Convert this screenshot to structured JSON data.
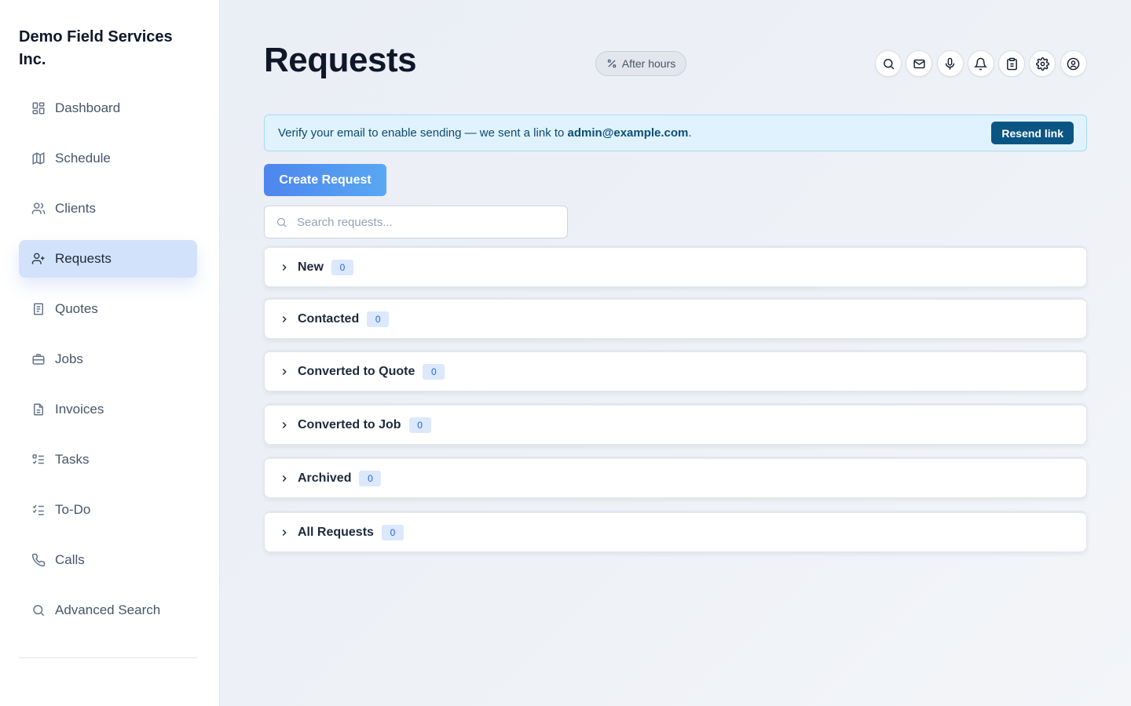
{
  "sidebar": {
    "brand": "Demo Field Services Inc.",
    "items": [
      {
        "label": "Dashboard",
        "icon": "dashboard-icon",
        "active": false
      },
      {
        "label": "Schedule",
        "icon": "map-icon",
        "active": false
      },
      {
        "label": "Clients",
        "icon": "users-icon",
        "active": false
      },
      {
        "label": "Requests",
        "icon": "user-plus-icon",
        "active": true
      },
      {
        "label": "Quotes",
        "icon": "document-icon",
        "active": false
      },
      {
        "label": "Jobs",
        "icon": "briefcase-icon",
        "active": false
      },
      {
        "label": "Invoices",
        "icon": "file-text-icon",
        "active": false
      },
      {
        "label": "Tasks",
        "icon": "list-checks-icon",
        "active": false
      },
      {
        "label": "To-Do",
        "icon": "checklist-icon",
        "active": false
      },
      {
        "label": "Calls",
        "icon": "phone-icon",
        "active": false
      },
      {
        "label": "Advanced Search",
        "icon": "search-icon",
        "active": false
      }
    ]
  },
  "header": {
    "title": "Requests",
    "status_badge": "After hours",
    "icons": [
      "search-icon",
      "mail-icon",
      "microphone-icon",
      "bell-icon",
      "clipboard-icon",
      "gear-icon",
      "user-circle-icon"
    ]
  },
  "banner": {
    "text_before": "Verify your email to enable sending — we sent a link to ",
    "email": "admin@example.com",
    "text_after": ".",
    "button": "Resend link"
  },
  "actions": {
    "create_button": "Create Request"
  },
  "search": {
    "placeholder": "Search requests...",
    "value": ""
  },
  "groups": [
    {
      "label": "New",
      "count": "0"
    },
    {
      "label": "Contacted",
      "count": "0"
    },
    {
      "label": "Converted to Quote",
      "count": "0"
    },
    {
      "label": "Converted to Job",
      "count": "0"
    },
    {
      "label": "Archived",
      "count": "0"
    },
    {
      "label": "All Requests",
      "count": "0"
    }
  ],
  "colors": {
    "accent": "#4d86ee",
    "active_nav_bg": "#d3e2fb",
    "banner_bg": "#e0f2fd",
    "banner_button": "#0b5584",
    "count_badge_bg": "#dce8fb"
  }
}
